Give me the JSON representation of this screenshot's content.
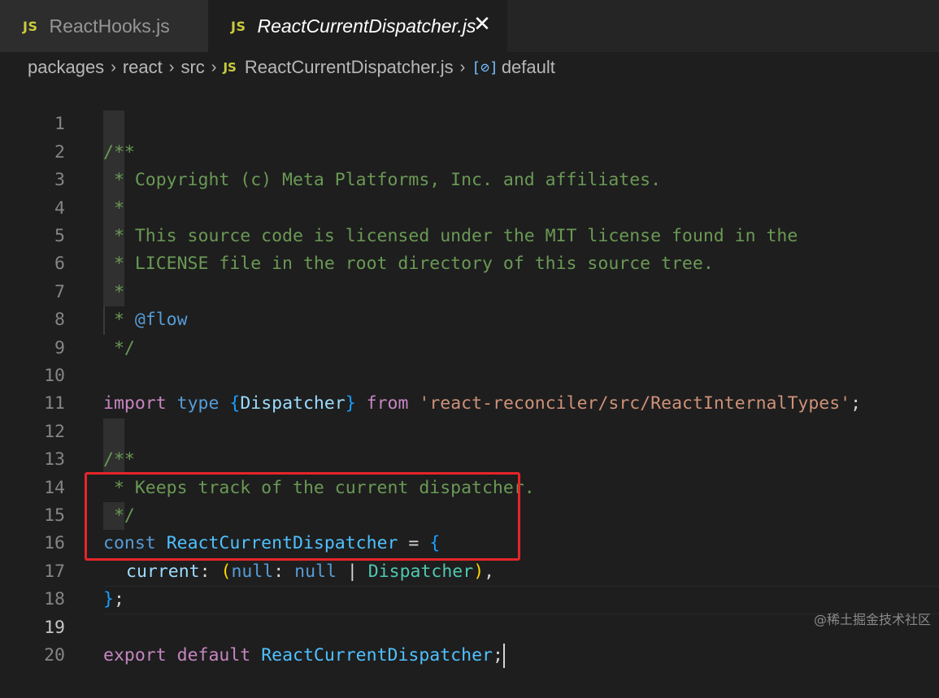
{
  "tabs": [
    {
      "label": "ReactHooks.js",
      "badge": "JS",
      "active": false
    },
    {
      "label": "ReactCurrentDispatcher.js",
      "badge": "JS",
      "active": true
    }
  ],
  "close_glyph": "✕",
  "breadcrumb": {
    "items": [
      "packages",
      "react",
      "src",
      "ReactCurrentDispatcher.js",
      "default"
    ],
    "file_badge": "JS",
    "symbol_glyph": "[⊘]",
    "separator": "›"
  },
  "editor": {
    "current_line": 19,
    "line_numbers": [
      "1",
      "2",
      "3",
      "4",
      "5",
      "6",
      "7",
      "8",
      "9",
      "10",
      "11",
      "12",
      "13",
      "14",
      "15",
      "16",
      "17",
      "18",
      "19",
      "20"
    ],
    "line1": "/**",
    "line2": " * Copyright (c) Meta Platforms, Inc. and affiliates.",
    "line3": " *",
    "line4": " * This source code is licensed under the MIT license found in the",
    "line5": " * LICENSE file in the root directory of this source tree.",
    "line6": " *",
    "line7_prefix": " * ",
    "line7_tag": "@flow",
    "line8": " */",
    "line10": {
      "import": "import",
      "type": "type",
      "open": "{",
      "name": "Dispatcher",
      "close": "}",
      "from": "from",
      "path": "'react-reconciler/src/ReactInternalTypes'",
      "semi": ";"
    },
    "line12": "/**",
    "line13": " * Keeps track of the current dispatcher.",
    "line14": " */",
    "line15": {
      "const": "const",
      "name": "ReactCurrentDispatcher",
      "eq": " = ",
      "open": "{"
    },
    "line16": {
      "prop": "current",
      "colon": ": ",
      "lparen": "(",
      "null1": "null",
      "colon2": ": ",
      "null2": "null",
      "pipe": " | ",
      "type": "Dispatcher",
      "rparen": ")",
      "comma": ","
    },
    "line17": {
      "close": "}",
      "semi": ";"
    },
    "line19": {
      "export": "export",
      "default": "default",
      "name": "ReactCurrentDispatcher",
      "semi": ";"
    }
  },
  "colors": {
    "highlight_box": "#e5252a",
    "comment": "#6a9955",
    "keyword": "#569cd6"
  },
  "watermark": "@稀土掘金技术社区"
}
